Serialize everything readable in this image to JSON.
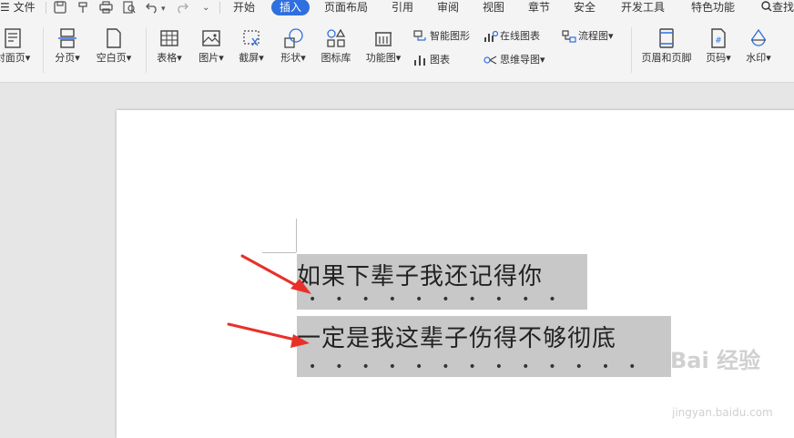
{
  "menubar": {
    "menu_label": "☰ 文件",
    "tabs": [
      "开始",
      "插入",
      "页面布局",
      "引用",
      "审阅",
      "视图",
      "章节",
      "安全",
      "开发工具",
      "特色功能"
    ],
    "active_tab": "插入",
    "search_label": "查找"
  },
  "ribbon": {
    "cover_page": "封面页",
    "page_break": "分页",
    "blank_page": "空白页",
    "table": "表格",
    "picture": "图片",
    "screenshot": "截屏",
    "shapes": "形状",
    "icon_library": "图标库",
    "function_chart": "功能图",
    "smart_graphic": "智能图形",
    "online_chart": "在线图表",
    "flowchart": "流程图",
    "chart": "图表",
    "mind_map": "思维导图",
    "header_footer": "页眉和页脚",
    "page_number": "页码",
    "watermark": "水印"
  },
  "document": {
    "line1": "如果下辈子我还记得你",
    "line2": "一定是我这辈子伤得不够彻底",
    "line1_dots": "••••••••••",
    "line2_dots": "•••••••••••••"
  },
  "watermark": {
    "logo": "Bai 经验",
    "url": "jingyan.baidu.com"
  },
  "colors": {
    "accent": "#2f6fde",
    "arrow": "#e8302a",
    "selection": "#c8c8c8"
  }
}
